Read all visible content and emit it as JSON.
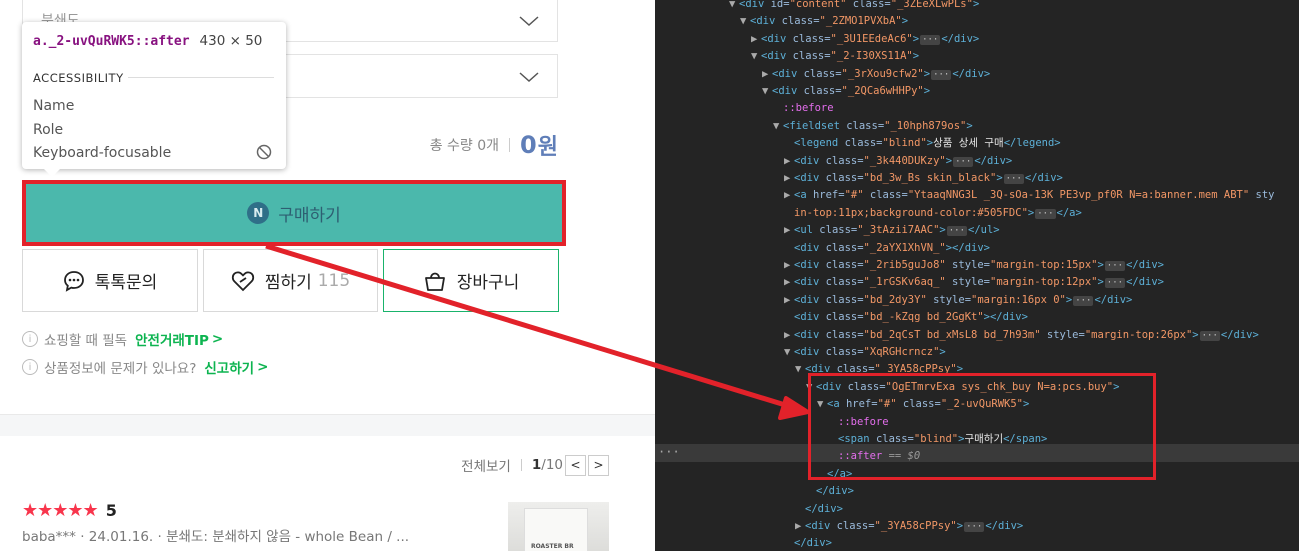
{
  "left": {
    "select_1": "분쇄도",
    "select_2": "",
    "total_qty": "총 수량 0개",
    "total_price": "0",
    "total_unit": "원",
    "buy_label": "구매하기",
    "buy_logo": "N",
    "talk_label": "톡톡문의",
    "wish_label": "찜하기",
    "wish_count": "115",
    "cart_label": "장바구니",
    "info_1_text": "쇼핑할 때 필독",
    "info_1_link": "안전거래TIP",
    "info_2_text": "상품정보에 문제가 있나요?",
    "info_2_link": "신고하기",
    "info_icon": "i",
    "link_arrow": ">",
    "pager": {
      "view_all": "전체보기",
      "current": "1",
      "total": "/10",
      "prev": "<",
      "next": ">"
    },
    "review": {
      "stars": "★★★★★",
      "score": "5",
      "meta": "baba*** · 24.01.16. · 분쇄도: 분쇄하지 않음 - whole Bean / ..."
    },
    "thumb_text": "ROASTER BR"
  },
  "tooltip": {
    "selector": "a._2-uvQuRWK5::after",
    "size": "430 × 50",
    "section": "ACCESSIBILITY",
    "name": "Name",
    "role": "Role",
    "focusable": "Keyboard-focusable"
  },
  "dom_lines": [
    {
      "indent": 0,
      "tri": "▼",
      "parts": [
        [
          "t",
          "<div "
        ],
        [
          "a",
          "id="
        ],
        [
          "v",
          "\"content\""
        ],
        [
          "a",
          " class="
        ],
        [
          "v",
          "\"_3ZEeXLwPLs\""
        ],
        [
          "t",
          ">"
        ]
      ]
    },
    {
      "indent": 1,
      "tri": "▼",
      "parts": [
        [
          "t",
          "<div "
        ],
        [
          "a",
          "class="
        ],
        [
          "v",
          "\"_2ZMO1PVXbA\""
        ],
        [
          "t",
          ">"
        ]
      ]
    },
    {
      "indent": 2,
      "tri": "▶",
      "parts": [
        [
          "t",
          "<div "
        ],
        [
          "a",
          "class="
        ],
        [
          "v",
          "\"_3U1EEdeAc6\""
        ],
        [
          "t",
          ">"
        ],
        [
          "d",
          "···"
        ],
        [
          "t",
          "</div>"
        ]
      ]
    },
    {
      "indent": 2,
      "tri": "▼",
      "parts": [
        [
          "t",
          "<div "
        ],
        [
          "a",
          "class="
        ],
        [
          "v",
          "\"_2-I30XS11A\""
        ],
        [
          "t",
          ">"
        ]
      ]
    },
    {
      "indent": 3,
      "tri": "▶",
      "parts": [
        [
          "t",
          "<div "
        ],
        [
          "a",
          "class="
        ],
        [
          "v",
          "\"_3rXou9cfw2\""
        ],
        [
          "t",
          ">"
        ],
        [
          "d",
          "···"
        ],
        [
          "t",
          "</div>"
        ]
      ]
    },
    {
      "indent": 3,
      "tri": "▼",
      "parts": [
        [
          "t",
          "<div "
        ],
        [
          "a",
          "class="
        ],
        [
          "v",
          "\"_2QCa6wHHPy\""
        ],
        [
          "t",
          ">"
        ]
      ]
    },
    {
      "indent": 4,
      "tri": "",
      "parts": [
        [
          "p",
          "::before"
        ]
      ]
    },
    {
      "indent": 4,
      "tri": "▼",
      "parts": [
        [
          "t",
          "<fieldset "
        ],
        [
          "a",
          "class="
        ],
        [
          "v",
          "\"_10hph879os\""
        ],
        [
          "t",
          ">"
        ]
      ]
    },
    {
      "indent": 5,
      "tri": "",
      "parts": [
        [
          "t",
          "<legend "
        ],
        [
          "a",
          "class="
        ],
        [
          "v",
          "\"blind\""
        ],
        [
          "t",
          ">"
        ],
        [
          "x",
          "상품 상세 구매"
        ],
        [
          "t",
          "</legend>"
        ]
      ]
    },
    {
      "indent": 5,
      "tri": "▶",
      "parts": [
        [
          "t",
          "<div "
        ],
        [
          "a",
          "class="
        ],
        [
          "v",
          "\"_3k440DUKzy\""
        ],
        [
          "t",
          ">"
        ],
        [
          "d",
          "···"
        ],
        [
          "t",
          "</div>"
        ]
      ]
    },
    {
      "indent": 5,
      "tri": "▶",
      "parts": [
        [
          "t",
          "<div "
        ],
        [
          "a",
          "class="
        ],
        [
          "v",
          "\"bd_3w_Bs skin_black\""
        ],
        [
          "t",
          ">"
        ],
        [
          "d",
          "···"
        ],
        [
          "t",
          "</div>"
        ]
      ]
    },
    {
      "indent": 5,
      "tri": "▶",
      "parts": [
        [
          "t",
          "<a "
        ],
        [
          "a",
          "href="
        ],
        [
          "v",
          "\"#\""
        ],
        [
          "a",
          " class="
        ],
        [
          "v",
          "\"YtaaqNNG3L _3Q-sOa-13K PE3vp_pf0R N=a:banner.mem ABT\""
        ],
        [
          "a",
          " sty"
        ]
      ]
    },
    {
      "indent": 5,
      "tri": "",
      "parts": [
        [
          "v",
          "in-top:11px;background-color:#505FDC\""
        ],
        [
          "t",
          ">"
        ],
        [
          "d",
          "···"
        ],
        [
          "t",
          "</a>"
        ]
      ]
    },
    {
      "indent": 5,
      "tri": "▶",
      "parts": [
        [
          "t",
          "<ul "
        ],
        [
          "a",
          "class="
        ],
        [
          "v",
          "\"_3tAzii7AAC\""
        ],
        [
          "t",
          ">"
        ],
        [
          "d",
          "···"
        ],
        [
          "t",
          "</ul>"
        ]
      ]
    },
    {
      "indent": 5,
      "tri": "",
      "parts": [
        [
          "t",
          "<div "
        ],
        [
          "a",
          "class="
        ],
        [
          "v",
          "\"_2aYX1XhVN_\""
        ],
        [
          "t",
          "></div>"
        ]
      ]
    },
    {
      "indent": 5,
      "tri": "▶",
      "parts": [
        [
          "t",
          "<div "
        ],
        [
          "a",
          "class="
        ],
        [
          "v",
          "\"_2rib5guJo8\""
        ],
        [
          "a",
          " style="
        ],
        [
          "v",
          "\"margin-top:15px\""
        ],
        [
          "t",
          ">"
        ],
        [
          "d",
          "···"
        ],
        [
          "t",
          "</div>"
        ]
      ]
    },
    {
      "indent": 5,
      "tri": "▶",
      "parts": [
        [
          "t",
          "<div "
        ],
        [
          "a",
          "class="
        ],
        [
          "v",
          "\"_1rGSKv6aq_\""
        ],
        [
          "a",
          " style="
        ],
        [
          "v",
          "\"margin-top:12px\""
        ],
        [
          "t",
          ">"
        ],
        [
          "d",
          "···"
        ],
        [
          "t",
          "</div>"
        ]
      ]
    },
    {
      "indent": 5,
      "tri": "▶",
      "parts": [
        [
          "t",
          "<div "
        ],
        [
          "a",
          "class="
        ],
        [
          "v",
          "\"bd_2dy3Y\""
        ],
        [
          "a",
          " style="
        ],
        [
          "v",
          "\"margin:16px 0\""
        ],
        [
          "t",
          ">"
        ],
        [
          "d",
          "···"
        ],
        [
          "t",
          "</div>"
        ]
      ]
    },
    {
      "indent": 5,
      "tri": "",
      "parts": [
        [
          "t",
          "<div "
        ],
        [
          "a",
          "class="
        ],
        [
          "v",
          "\"bd_-kZqg bd_2GgKt\""
        ],
        [
          "t",
          "></div>"
        ]
      ]
    },
    {
      "indent": 5,
      "tri": "▶",
      "parts": [
        [
          "t",
          "<div "
        ],
        [
          "a",
          "class="
        ],
        [
          "v",
          "\"bd_2qCsT bd_xMsL8 bd_7h93m\""
        ],
        [
          "a",
          " style="
        ],
        [
          "v",
          "\"margin-top:26px\""
        ],
        [
          "t",
          ">"
        ],
        [
          "d",
          "···"
        ],
        [
          "t",
          "</div>"
        ]
      ]
    },
    {
      "indent": 5,
      "tri": "▼",
      "parts": [
        [
          "t",
          "<div "
        ],
        [
          "a",
          "class="
        ],
        [
          "v",
          "\"XqRGHcrncz\""
        ],
        [
          "t",
          ">"
        ]
      ]
    },
    {
      "indent": 6,
      "tri": "▼",
      "parts": [
        [
          "t",
          "<div "
        ],
        [
          "a",
          "class="
        ],
        [
          "v",
          "\"_3YA58cPPsy\""
        ],
        [
          "t",
          ">"
        ]
      ]
    },
    {
      "indent": 7,
      "tri": "▼",
      "parts": [
        [
          "t",
          "<div "
        ],
        [
          "a",
          "class="
        ],
        [
          "v",
          "\"OgETmrvExa sys_chk_buy N=a:pcs.buy\""
        ],
        [
          "t",
          ">"
        ]
      ]
    },
    {
      "indent": 8,
      "tri": "▼",
      "parts": [
        [
          "t",
          "<a "
        ],
        [
          "a",
          "href="
        ],
        [
          "v",
          "\"#\""
        ],
        [
          "a",
          " class="
        ],
        [
          "v",
          "\"_2-uvQuRWK5\""
        ],
        [
          "t",
          ">"
        ]
      ]
    },
    {
      "indent": 9,
      "tri": "",
      "parts": [
        [
          "p",
          "::before"
        ]
      ]
    },
    {
      "indent": 9,
      "tri": "",
      "parts": [
        [
          "t",
          "<span "
        ],
        [
          "a",
          "class="
        ],
        [
          "v",
          "\"blind\""
        ],
        [
          "t",
          ">"
        ],
        [
          "x",
          "구매하기"
        ],
        [
          "t",
          "</span>"
        ]
      ]
    },
    {
      "indent": 9,
      "tri": "",
      "parts": [
        [
          "p",
          "::after"
        ],
        [
          "e",
          " == $0"
        ]
      ]
    },
    {
      "indent": 8,
      "tri": "",
      "parts": [
        [
          "t",
          "</a>"
        ]
      ]
    },
    {
      "indent": 7,
      "tri": "",
      "parts": [
        [
          "t",
          "</div>"
        ]
      ]
    },
    {
      "indent": 6,
      "tri": "",
      "parts": [
        [
          "t",
          "</div>"
        ]
      ]
    },
    {
      "indent": 6,
      "tri": "▶",
      "parts": [
        [
          "t",
          "<div "
        ],
        [
          "a",
          "class="
        ],
        [
          "v",
          "\"_3YA58cPPsy\""
        ],
        [
          "t",
          ">"
        ],
        [
          "d",
          "···"
        ],
        [
          "t",
          "</div>"
        ]
      ]
    },
    {
      "indent": 5,
      "tri": "",
      "parts": [
        [
          "t",
          "</div>"
        ]
      ]
    }
  ],
  "devtools_ellipsis": "···",
  "colors": {
    "highlight_red": "#e2222a",
    "buy_teal": "#4bb8ac",
    "naver_green": "#0db450",
    "price_blue": "#5f7eb8",
    "star_red": "#f8354c",
    "devtools_bg": "#242424"
  }
}
